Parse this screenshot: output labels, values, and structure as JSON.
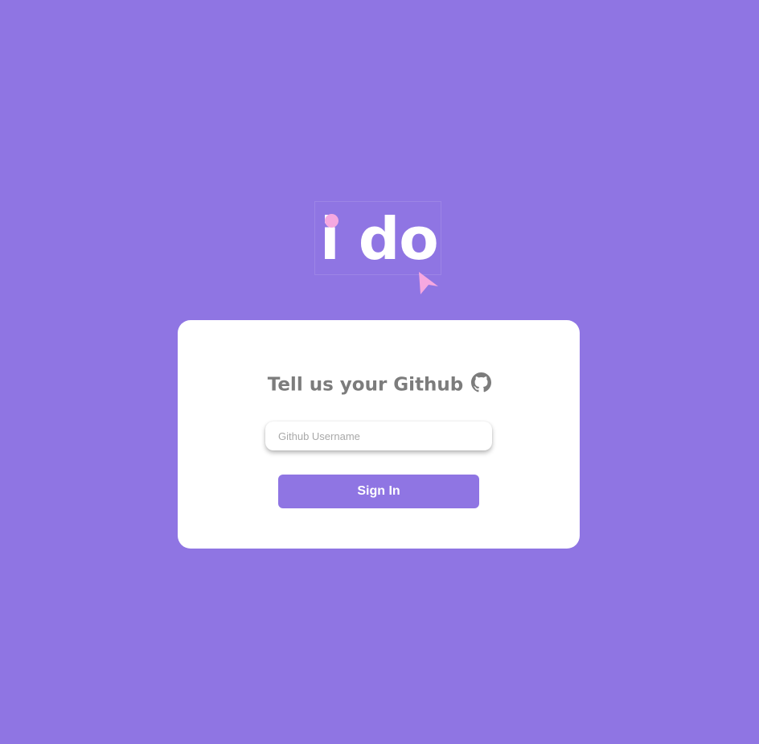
{
  "colors": {
    "background": "#8f75e3",
    "card": "#ffffff",
    "accent_pink": "#f6a8e0",
    "title_gray": "#7c7c7c",
    "button": "#8f75e3"
  },
  "logo": {
    "text": "i do",
    "icon": "cursor-arrow-icon"
  },
  "login_card": {
    "title": "Tell us your Github",
    "title_icon": "github-icon",
    "username_input": {
      "placeholder": "Github Username",
      "value": ""
    },
    "signin_label": "Sign In"
  }
}
